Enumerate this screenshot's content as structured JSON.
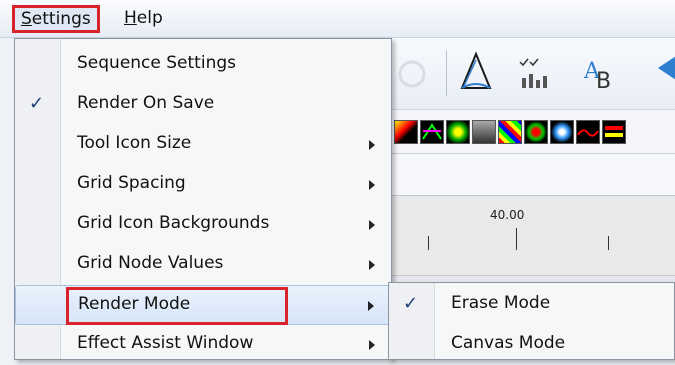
{
  "menubar": {
    "items": [
      {
        "label": "Settings",
        "mnemonic": "S",
        "rest": "ettings"
      },
      {
        "label": "Help",
        "mnemonic": "H",
        "rest": "elp"
      }
    ]
  },
  "settings_menu": {
    "items": [
      {
        "label": "Sequence Settings",
        "checked": false,
        "submenu": false
      },
      {
        "label": "Render On Save",
        "checked": true,
        "submenu": false,
        "check": "✓"
      },
      {
        "label": "Tool Icon Size",
        "checked": false,
        "submenu": true
      },
      {
        "label": "Grid Spacing",
        "checked": false,
        "submenu": true
      },
      {
        "label": "Grid Icon Backgrounds",
        "checked": false,
        "submenu": true
      },
      {
        "label": "Grid Node Values",
        "checked": false,
        "submenu": true
      },
      {
        "label": "Render Mode",
        "checked": false,
        "submenu": true,
        "highlighted": true
      },
      {
        "label": "Effect Assist Window",
        "checked": false,
        "submenu": true
      }
    ]
  },
  "render_mode_submenu": {
    "items": [
      {
        "label": "Erase Mode",
        "checked": true,
        "check": "✓"
      },
      {
        "label": "Canvas Mode",
        "checked": false
      }
    ]
  },
  "timeline": {
    "ruler_label": "40.00"
  },
  "colors": {
    "highlight_box": "#d8232a",
    "check": "#1e3f7a",
    "menu_bg": "#f6f7f9"
  }
}
